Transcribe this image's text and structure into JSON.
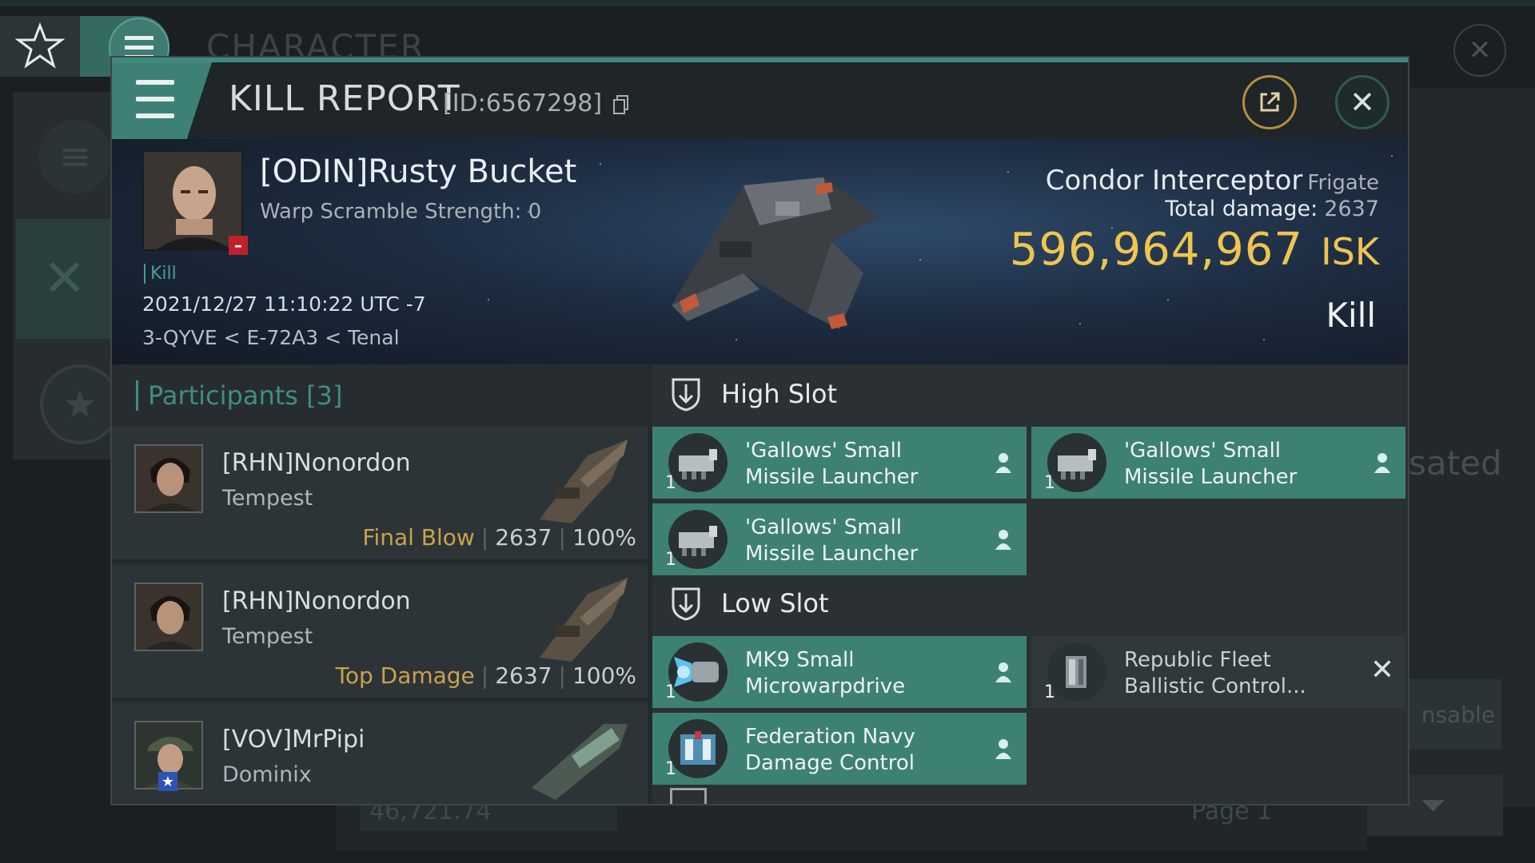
{
  "background": {
    "title": "CHARACTER",
    "logo": "NES",
    "partial_right_1": "sated",
    "partial_right_2": "nsable",
    "bottom_value": "46,721.74",
    "bottom_page": "Page 1"
  },
  "modal": {
    "title": "KILL REPORT",
    "id": "[ID:6567298]",
    "victim": {
      "name": "[ODIN]Rusty Bucket",
      "warp_scramble": "Warp Scramble Strength: 0",
      "tag": "Kill",
      "datetime": "2021/12/27 11:10:22 UTC -7",
      "location": "3-QYVE < E-72A3 < Tenal"
    },
    "ship": {
      "name": "Condor Interceptor",
      "class": "Frigate",
      "total_damage_label": "Total damage:",
      "total_damage": "2637",
      "isk_value": "596,964,967",
      "isk_unit": "ISK",
      "result": "Kill"
    },
    "participants": {
      "label": "Participants",
      "count": "[3]",
      "items": [
        {
          "name": "[RHN]Nonordon",
          "ship": "Tempest",
          "role": "Final Blow",
          "damage": "2637",
          "percent": "100%"
        },
        {
          "name": "[RHN]Nonordon",
          "ship": "Tempest",
          "role": "Top Damage",
          "damage": "2637",
          "percent": "100%"
        },
        {
          "name": "[VOV]MrPipi",
          "ship": "Dominix"
        }
      ]
    },
    "fitting": {
      "high_slot": {
        "title": "High Slot",
        "modules": [
          {
            "line1": "'Gallows' Small",
            "line2": "Missile Launcher",
            "qty": "1"
          },
          {
            "line1": "'Gallows' Small",
            "line2": "Missile Launcher",
            "qty": "1"
          },
          {
            "line1": "'Gallows' Small",
            "line2": "Missile Launcher",
            "qty": "1"
          }
        ]
      },
      "low_slot": {
        "title": "Low Slot",
        "modules": [
          {
            "line1": "MK9 Small",
            "line2": "Microwarpdrive",
            "qty": "1"
          },
          {
            "line1": "Republic Fleet",
            "line2": "Ballistic Control...",
            "qty": "1"
          },
          {
            "line1": "Federation Navy",
            "line2": "Damage Control",
            "qty": "1"
          }
        ]
      }
    }
  },
  "colors": {
    "accent": "#3f8a80",
    "isk": "#f0c44f",
    "role": "#c9a24b",
    "module_fitted": "#3d8174",
    "module_destroyed": "#30383c"
  },
  "icons": [
    "menu-icon",
    "export-icon",
    "close-icon",
    "copy-icon",
    "high-slot-icon",
    "low-slot-icon",
    "person-icon",
    "destroyed-x-icon",
    "star-icon",
    "crossed-swords-icon"
  ]
}
